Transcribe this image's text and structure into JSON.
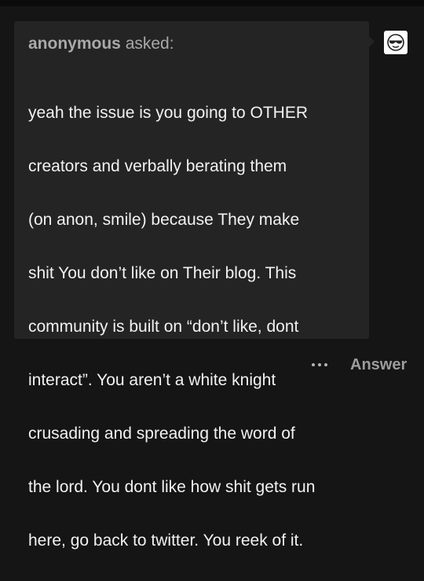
{
  "ask": {
    "asker_name": "anonymous",
    "asked_label": "asked:",
    "lines": [
      "yeah the issue is you going to OTHER",
      "creators and verbally berating them",
      "(on anon, smile) because They make",
      "shit You don’t like on Their blog. This",
      "community is built on “don’t like, dont",
      "interact”. You aren’t a white knight",
      "crusading and spreading the word of",
      "the lord. You dont like how shit gets run",
      "here, go back to twitter. You reek of it."
    ]
  },
  "avatar": {
    "icon": "anonymous-sunglasses-face-icon"
  },
  "footer": {
    "more_icon": "ellipsis-icon",
    "answer_label": "Answer"
  },
  "colors": {
    "page_background": "#151515",
    "bubble_background": "#242424",
    "question_text": "#f2f2f2",
    "muted_text": "#a9a9a9"
  }
}
